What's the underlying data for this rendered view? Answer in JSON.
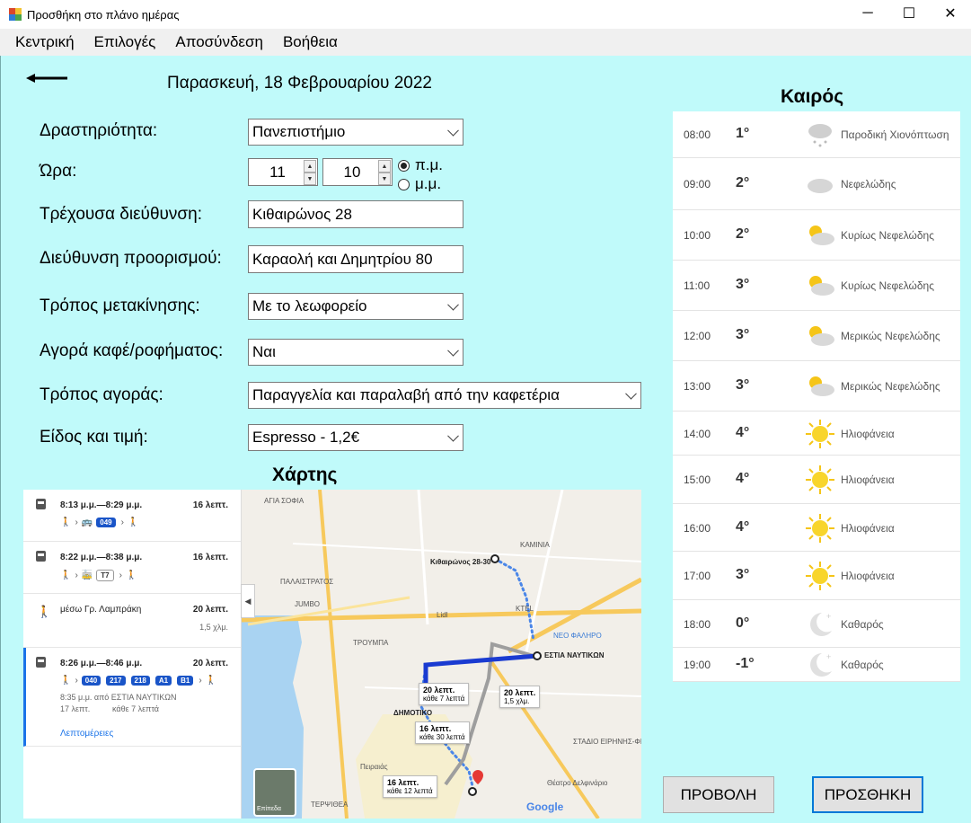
{
  "window": {
    "title": "Προσθήκη στο πλάνο ημέρας",
    "minimize": "─",
    "maximize": "☐",
    "close": "✕"
  },
  "menu": {
    "items": [
      "Κεντρική",
      "Επιλογές",
      "Αποσύνδεση",
      "Βοήθεια"
    ]
  },
  "header": {
    "date": "Παρασκευή, 18 Φεβρουαρίου 2022"
  },
  "form": {
    "activity": {
      "label": "Δραστηριότητα:",
      "value": "Πανεπιστήμιο"
    },
    "time": {
      "label": "Ώρα:",
      "hour": "11",
      "minute": "10",
      "am_label": "π.μ.",
      "pm_label": "μ.μ.",
      "selected": "am"
    },
    "current_address": {
      "label": "Τρέχουσα διεύθυνση:",
      "value": "Κιθαιρώνος 28"
    },
    "destination_address": {
      "label": "Διεύθυνση προορισμού:",
      "value": "Καραολή και Δημητρίου 80"
    },
    "transport_mode": {
      "label": "Τρόπος μετακίνησης:",
      "value": "Με το λεωφορείο"
    },
    "buy_coffee": {
      "label": "Αγορά καφέ/ροφήματος:",
      "value": "Ναι"
    },
    "purchase_method": {
      "label": "Τρόπος αγοράς:",
      "value": "Παραγγελία και παραλαβή από την καφετέρια"
    },
    "item_price": {
      "label": "Είδος και τιμή:",
      "value": "Espresso - 1,2€"
    }
  },
  "map": {
    "title": "Χάρτης",
    "routes": [
      {
        "time": "8:13 μ.μ.—8:29 μ.μ.",
        "duration": "16 λεπτ.",
        "badges": [
          "049"
        ]
      },
      {
        "time": "8:22 μ.μ.—8:38 μ.μ.",
        "duration": "16 λεπτ.",
        "badges": [
          "T7"
        ]
      },
      {
        "time": "μέσω Γρ. Λαμπράκη",
        "duration": "20 λεπτ.",
        "distance": "1,5 χλμ."
      },
      {
        "time": "8:26 μ.μ.—8:46 μ.μ.",
        "duration": "20 λεπτ.",
        "badges": [
          "040",
          "217",
          "218",
          "A1",
          "B1"
        ],
        "detail1": "8:35 μ.μ. από ΕΣΤΙΑ ΝΑΥΤΙΚΩΝ",
        "detail2a": "17 λεπτ.",
        "detail2b": "κάθε 7 λεπτά",
        "link": "Λεπτομέρειες"
      }
    ],
    "labels": {
      "agia_sofia": "ΑΓΙΑ ΣΟΦΙΑ",
      "kaminia": "ΚΑΜΙΝΙΑ",
      "palastratoi": "ΠΑΛΑΙΣΤΡΑΤΟΣ",
      "start": "Κιθαιρώνος 28-30",
      "neo_faliro": "ΝΕΟ ΦΑΛΗΡΟ",
      "troumba": "ΤΡΟΥΜΠΑ",
      "estia": "ΕΣΤΙΑ ΝΑΥΤΙΚΩΝ",
      "dimotiko": "ΔΗΜΟΤΙΚΟ",
      "peiraias": "Πειραιάς",
      "terpsithea": "ΤΕΡΨΙΘΕΑ",
      "jumbo": "JUMBO",
      "lidl": "Lidl",
      "ktel": "KTEL",
      "stadio": "ΣΤΑΔΙΟ ΕΙΡΗΝΗΣ-ΦΙΛΙΑΣ ΣΕΦ",
      "theatro": "Θέατρο Δελφινάριο",
      "google": "Google",
      "layers": "Επίπεδα",
      "callout1_dur": "20 λεπτ.",
      "callout1_sub": "κάθε 7 λεπτά",
      "callout2_dur": "20 λεπτ.",
      "callout2_sub": "1,5 χλμ.",
      "callout3_dur": "16 λεπτ.",
      "callout3_sub": "κάθε 30 λεπτά",
      "callout4_dur": "16 λεπτ.",
      "callout4_sub": "κάθε 12 λεπτά"
    }
  },
  "weather": {
    "title": "Καιρός",
    "rows": [
      {
        "time": "08:00",
        "temp": "1°",
        "icon": "snow-cloud-icon",
        "desc": "Παροδική Χιονόπτωση"
      },
      {
        "time": "09:00",
        "temp": "2°",
        "icon": "cloud-icon",
        "desc": "Νεφελώδης"
      },
      {
        "time": "10:00",
        "temp": "2°",
        "icon": "sun-cloud-icon",
        "desc": "Κυρίως Νεφελώδης"
      },
      {
        "time": "11:00",
        "temp": "3°",
        "icon": "sun-cloud-icon",
        "desc": "Κυρίως Νεφελώδης"
      },
      {
        "time": "12:00",
        "temp": "3°",
        "icon": "sun-cloud-icon",
        "desc": "Μερικώς Νεφελώδης"
      },
      {
        "time": "13:00",
        "temp": "3°",
        "icon": "sun-cloud-icon",
        "desc": "Μερικώς Νεφελώδης"
      },
      {
        "time": "14:00",
        "temp": "4°",
        "icon": "sun-icon",
        "desc": "Ηλιοφάνεια"
      },
      {
        "time": "15:00",
        "temp": "4°",
        "icon": "sun-icon",
        "desc": "Ηλιοφάνεια"
      },
      {
        "time": "16:00",
        "temp": "4°",
        "icon": "sun-icon",
        "desc": "Ηλιοφάνεια"
      },
      {
        "time": "17:00",
        "temp": "3°",
        "icon": "sun-icon",
        "desc": "Ηλιοφάνεια"
      },
      {
        "time": "18:00",
        "temp": "0°",
        "icon": "moon-icon",
        "desc": "Καθαρός"
      },
      {
        "time": "19:00",
        "temp": "-1°",
        "icon": "moon-icon",
        "desc": "Καθαρός"
      }
    ]
  },
  "buttons": {
    "view": "ΠΡΟΒΟΛΗ",
    "add": "ΠΡΟΣΘΗΚΗ"
  }
}
